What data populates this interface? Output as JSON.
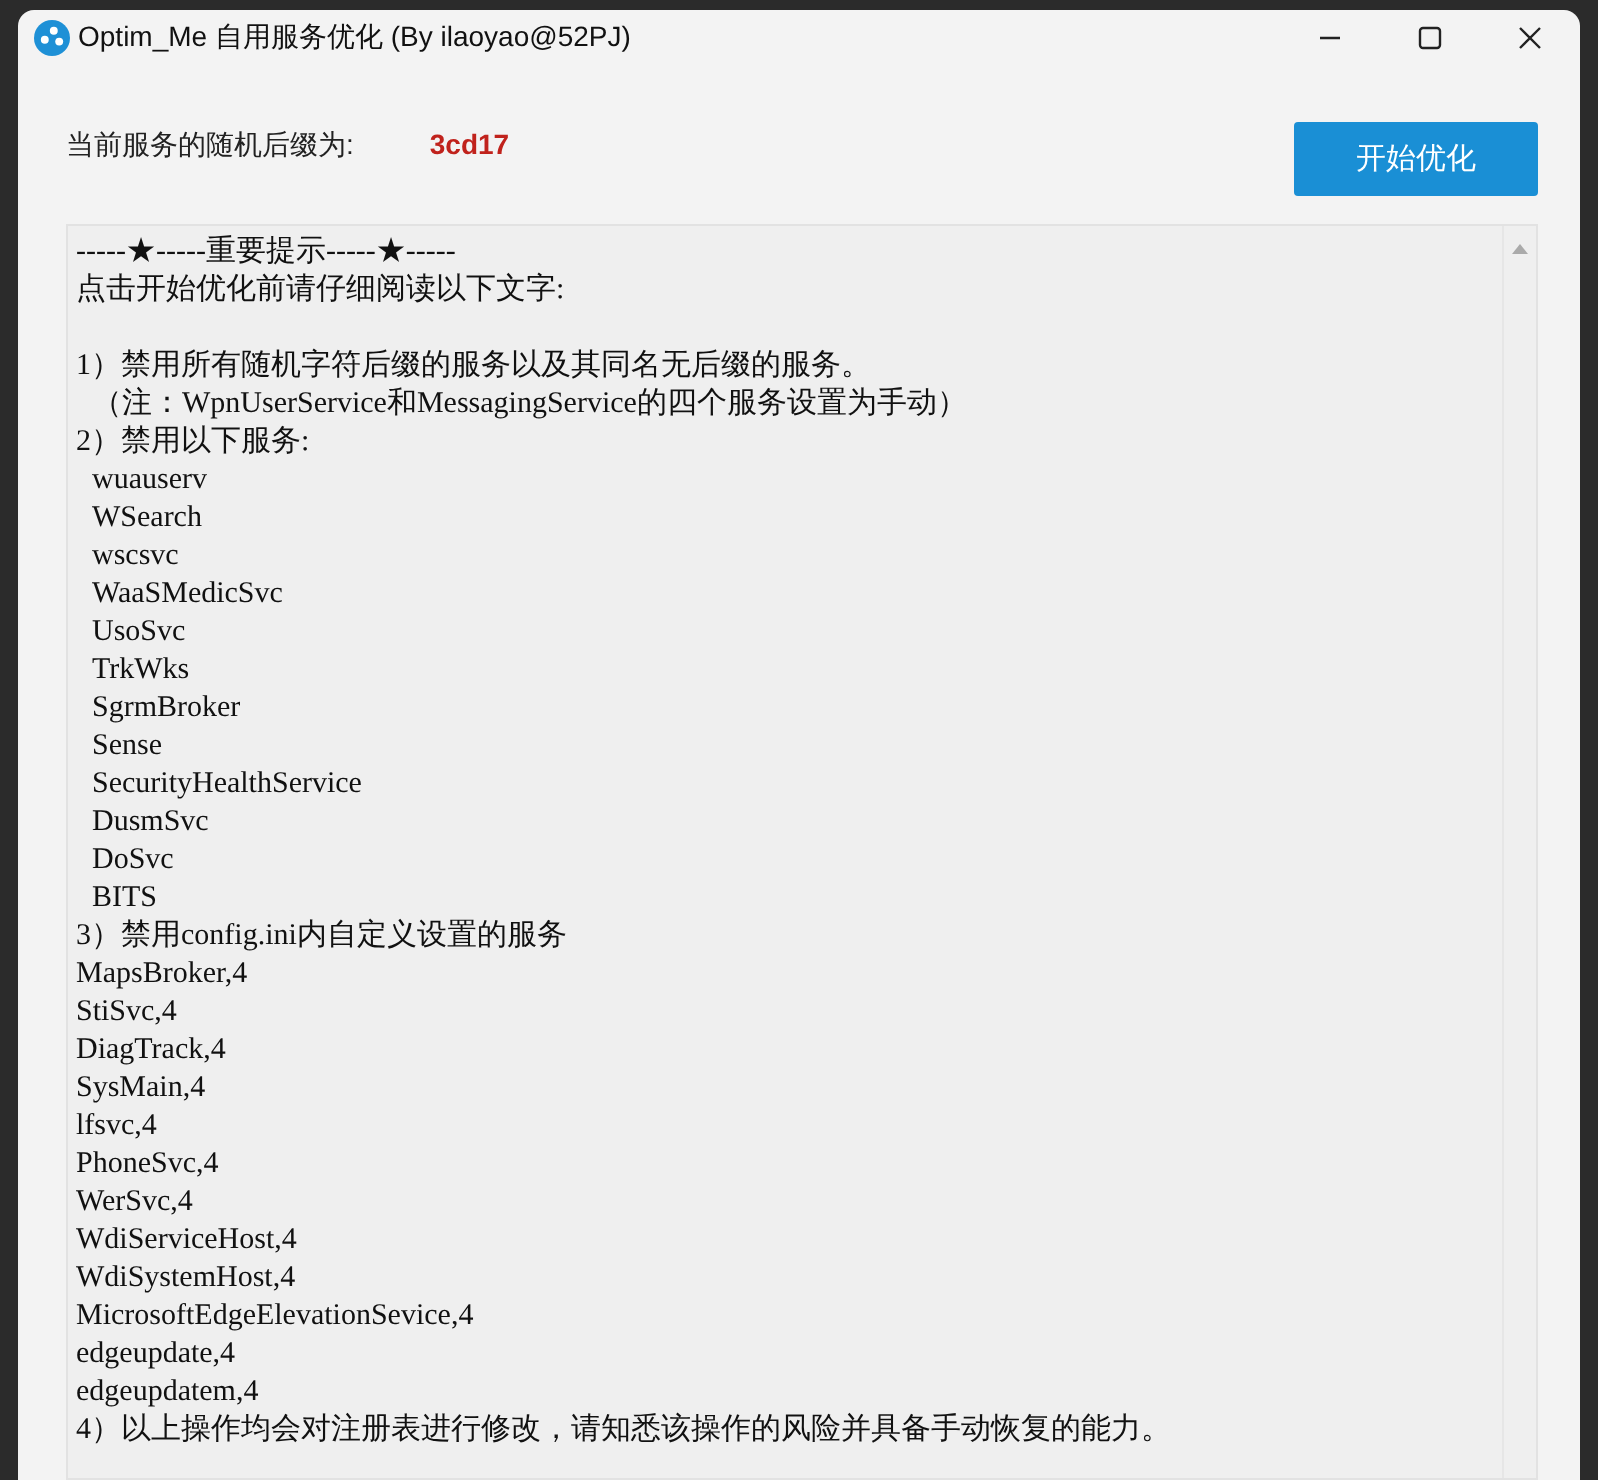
{
  "window": {
    "title": "Optim_Me 自用服务优化 (By ilaoyao@52PJ)"
  },
  "suffix": {
    "label": "当前服务的随机后缀为:",
    "value": "3cd17"
  },
  "start_button": {
    "label": "开始优化"
  },
  "notice": {
    "lines": [
      {
        "text": "-----★-----重要提示-----★-----",
        "indent": false,
        "gap_before": false
      },
      {
        "text": "点击开始优化前请仔细阅读以下文字:",
        "indent": false,
        "gap_before": false
      },
      {
        "text": "1）禁用所有随机字符后缀的服务以及其同名无后缀的服务。",
        "indent": false,
        "gap_before": true
      },
      {
        "text": "（注：WpnUserService和MessagingService的四个服务设置为手动）",
        "indent": true,
        "gap_before": false
      },
      {
        "text": "2）禁用以下服务:",
        "indent": false,
        "gap_before": false
      },
      {
        "text": "wuauserv",
        "indent": true,
        "gap_before": false
      },
      {
        "text": "WSearch",
        "indent": true,
        "gap_before": false
      },
      {
        "text": "wscsvc",
        "indent": true,
        "gap_before": false
      },
      {
        "text": "WaaSMedicSvc",
        "indent": true,
        "gap_before": false
      },
      {
        "text": "UsoSvc",
        "indent": true,
        "gap_before": false
      },
      {
        "text": "TrkWks",
        "indent": true,
        "gap_before": false
      },
      {
        "text": "SgrmBroker",
        "indent": true,
        "gap_before": false
      },
      {
        "text": "Sense",
        "indent": true,
        "gap_before": false
      },
      {
        "text": "SecurityHealthService",
        "indent": true,
        "gap_before": false
      },
      {
        "text": "DusmSvc",
        "indent": true,
        "gap_before": false
      },
      {
        "text": "DoSvc",
        "indent": true,
        "gap_before": false
      },
      {
        "text": "BITS",
        "indent": true,
        "gap_before": false
      },
      {
        "text": "3）禁用config.ini内自定义设置的服务",
        "indent": false,
        "gap_before": false
      },
      {
        "text": "MapsBroker,4",
        "indent": false,
        "gap_before": false
      },
      {
        "text": "StiSvc,4",
        "indent": false,
        "gap_before": false
      },
      {
        "text": "DiagTrack,4",
        "indent": false,
        "gap_before": false
      },
      {
        "text": "SysMain,4",
        "indent": false,
        "gap_before": false
      },
      {
        "text": "lfsvc,4",
        "indent": false,
        "gap_before": false
      },
      {
        "text": "PhoneSvc,4",
        "indent": false,
        "gap_before": false
      },
      {
        "text": "WerSvc,4",
        "indent": false,
        "gap_before": false
      },
      {
        "text": "WdiServiceHost,4",
        "indent": false,
        "gap_before": false
      },
      {
        "text": "WdiSystemHost,4",
        "indent": false,
        "gap_before": false
      },
      {
        "text": "MicrosoftEdgeElevationSevice,4",
        "indent": false,
        "gap_before": false
      },
      {
        "text": "edgeupdate,4",
        "indent": false,
        "gap_before": false
      },
      {
        "text": "edgeupdatem,4",
        "indent": false,
        "gap_before": false
      },
      {
        "text": "4）以上操作均会对注册表进行修改，请知悉该操作的风险并具备手动恢复的能力。",
        "indent": false,
        "gap_before": false
      }
    ]
  }
}
